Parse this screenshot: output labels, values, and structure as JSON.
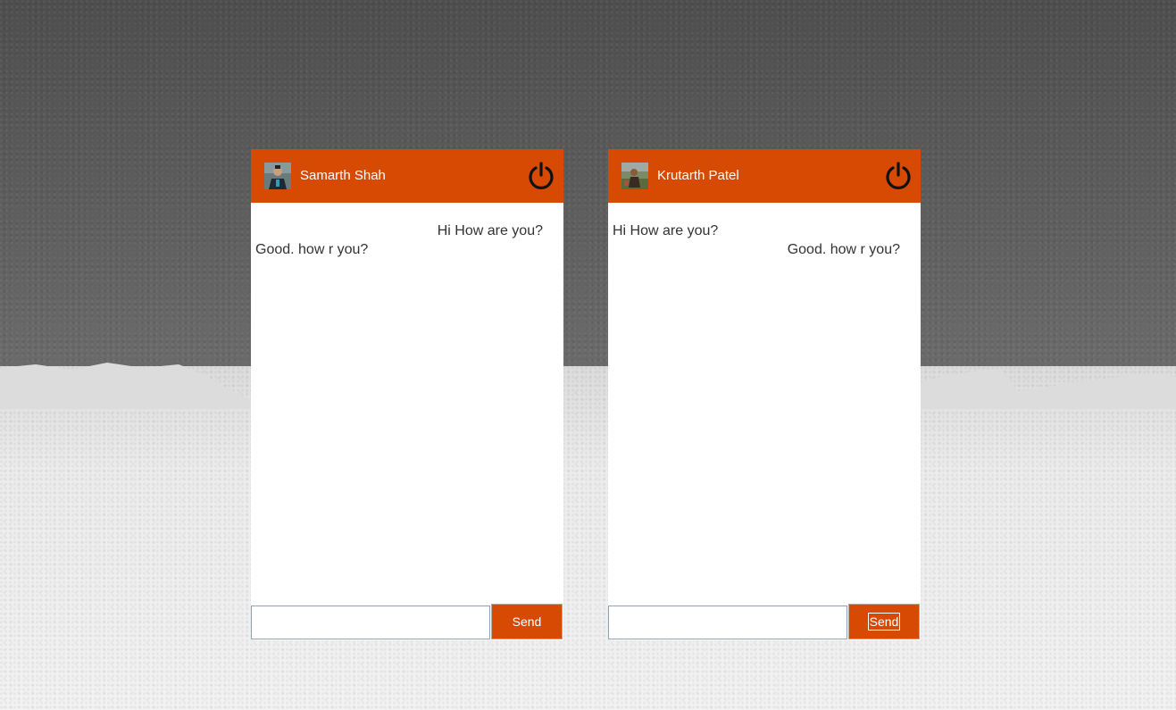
{
  "colors": {
    "accent": "#d64a04",
    "panel_background": "#ffffff",
    "message_text": "#333333",
    "header_text": "#ffffff"
  },
  "chats": [
    {
      "user_name": "Samarth Shah",
      "avatar_icon": "user-avatar-icon",
      "power_icon": "power-icon",
      "messages": [
        {
          "text": "Hi How are you?",
          "direction": "sent"
        },
        {
          "text": "Good. how r you?",
          "direction": "received"
        }
      ],
      "input_value": "",
      "send_label": "Send"
    },
    {
      "user_name": "Krutarth Patel",
      "avatar_icon": "user-avatar-icon",
      "power_icon": "power-icon",
      "messages": [
        {
          "text": "Hi How are you?",
          "direction": "received"
        },
        {
          "text": "Good. how r you?",
          "direction": "sent"
        }
      ],
      "input_value": "",
      "send_label": "Send"
    }
  ]
}
